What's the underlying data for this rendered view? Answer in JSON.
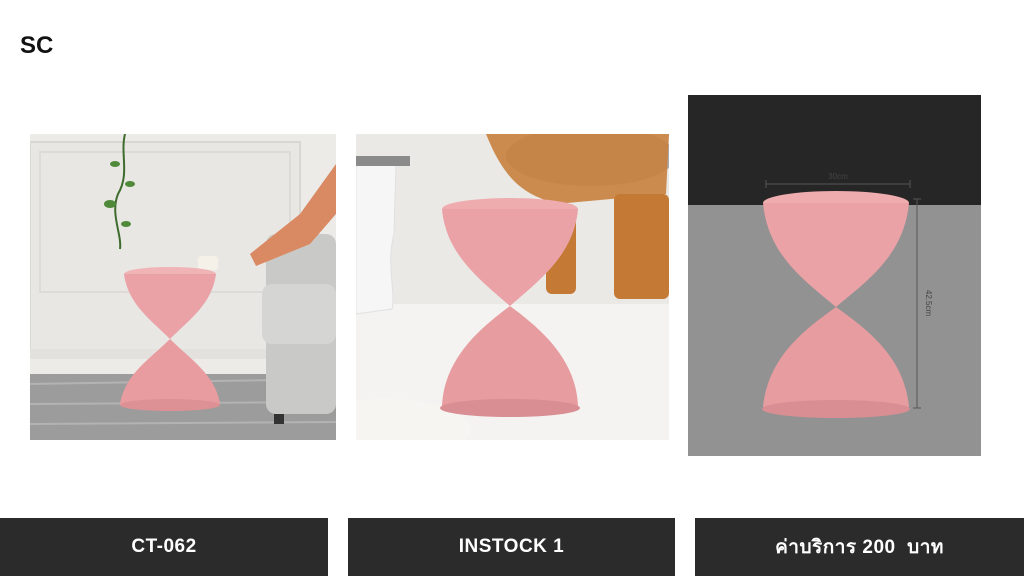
{
  "brand": {
    "logo_text": "SC"
  },
  "photos": [
    {
      "name": "room-scene"
    },
    {
      "name": "closeup-scene"
    },
    {
      "name": "dimension-scene",
      "width_label": "30cm",
      "height_label": "42.5cm"
    }
  ],
  "footer": {
    "code_label": "CT-062",
    "stock_label": "INSTOCK 1",
    "price_label": "ค่าบริการ 200  บาท"
  },
  "colors": {
    "product_pink": "#eaa2a6",
    "bar_bg": "#2b2b2b",
    "bar_text": "#ffffff"
  }
}
